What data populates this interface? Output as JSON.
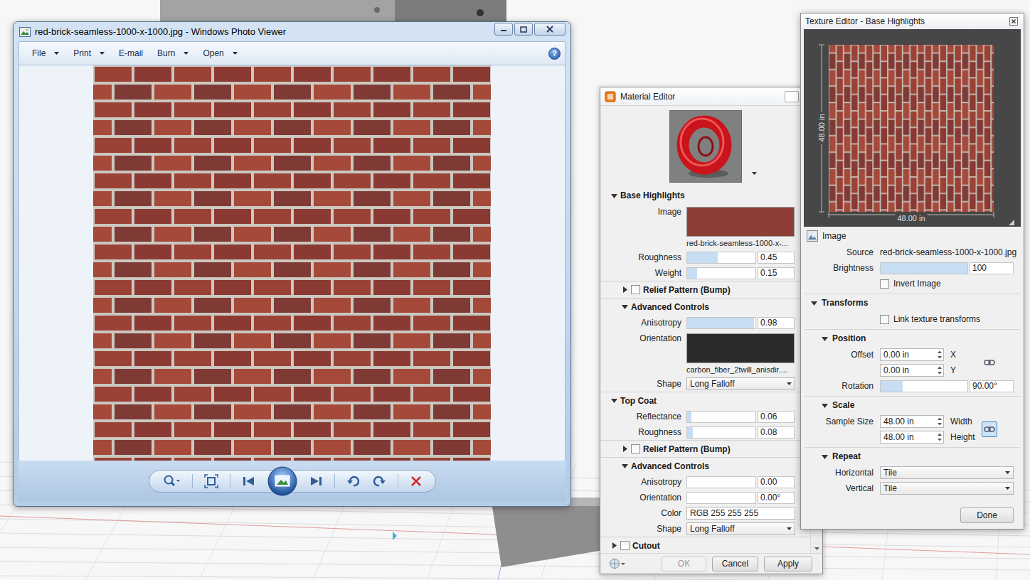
{
  "photo_viewer": {
    "title": "red-brick-seamless-1000-x-1000.jpg - Windows Photo Viewer",
    "menu": [
      {
        "label": "File",
        "has_dropdown": true
      },
      {
        "label": "Print",
        "has_dropdown": true
      },
      {
        "label": "E-mail",
        "has_dropdown": false
      },
      {
        "label": "Burn",
        "has_dropdown": true
      },
      {
        "label": "Open",
        "has_dropdown": true
      }
    ],
    "help": "?"
  },
  "material_editor": {
    "title": "Material Editor",
    "rows": [
      {
        "kind": "section",
        "label": "Base Highlights",
        "expanded": true,
        "has_checkbox": false
      },
      {
        "kind": "image",
        "label": "Image",
        "file": "red-brick-seamless-1000-x-...",
        "color": "#8e3f35"
      },
      {
        "kind": "slider",
        "label": "Roughness",
        "level": 0.45,
        "value": "0.45"
      },
      {
        "kind": "slider",
        "label": "Weight",
        "level": 0.15,
        "value": "0.15"
      },
      {
        "kind": "subsection",
        "label": "Relief Pattern (Bump)",
        "expanded": false,
        "has_checkbox": true,
        "checked": false
      },
      {
        "kind": "subsection",
        "label": "Advanced Controls",
        "expanded": true,
        "has_checkbox": false
      },
      {
        "kind": "slider",
        "label": "Anisotropy",
        "level": 0.98,
        "value": "0.98"
      },
      {
        "kind": "image",
        "label": "Orientation",
        "file": "carbon_fiber_2twill_anisdir....",
        "color": "#2b2b2b"
      },
      {
        "kind": "select",
        "label": "Shape",
        "value": "Long Falloff"
      },
      {
        "kind": "section",
        "label": "Top Coat",
        "expanded": true,
        "has_checkbox": false
      },
      {
        "kind": "slider",
        "label": "Reflectance",
        "level": 0.06,
        "value": "0.06"
      },
      {
        "kind": "slider",
        "label": "Roughness",
        "level": 0.08,
        "value": "0.08"
      },
      {
        "kind": "subsection",
        "label": "Relief Pattern (Bump)",
        "expanded": false,
        "has_checkbox": true,
        "checked": false
      },
      {
        "kind": "subsection",
        "label": "Advanced Controls",
        "expanded": true,
        "has_checkbox": false
      },
      {
        "kind": "slider",
        "label": "Anisotropy",
        "level": 0,
        "value": "0.00"
      },
      {
        "kind": "slider",
        "label": "Orientation",
        "level": 0,
        "value": "0.00°"
      },
      {
        "kind": "field",
        "label": "Color",
        "value": "RGB 255 255 255"
      },
      {
        "kind": "select",
        "label": "Shape",
        "value": "Long Falloff"
      },
      {
        "kind": "section",
        "label": "Cutout",
        "expanded": false,
        "has_checkbox": true,
        "checked": false
      }
    ],
    "buttons": [
      {
        "label": "OK",
        "disabled": true
      },
      {
        "label": "Cancel",
        "disabled": false
      },
      {
        "label": "Apply",
        "disabled": false
      }
    ]
  },
  "texture_editor": {
    "title": "Texture Editor - Base Highlights",
    "preview": {
      "height_label": "48.00 in",
      "width_label": "48.00 in"
    },
    "image_header": "Image",
    "source": {
      "label": "Source",
      "value": "red-brick-seamless-1000-x-1000.jpg"
    },
    "brightness": {
      "label": "Brightness",
      "level": 1,
      "value": "100"
    },
    "invert": {
      "label": "Invert Image",
      "checked": false
    },
    "transforms": {
      "label": "Transforms",
      "expanded": true,
      "link": {
        "label": "Link texture transforms",
        "checked": false
      }
    },
    "position": {
      "label": "Position",
      "expanded": true,
      "offset_label": "Offset",
      "x": {
        "value": "0.00 in",
        "axis": "X"
      },
      "y": {
        "value": "0.00 in",
        "axis": "Y"
      },
      "linked": false,
      "rotation": {
        "label": "Rotation",
        "level": 0.25,
        "value": "90.00°"
      }
    },
    "scale": {
      "label": "Scale",
      "expanded": true,
      "size_label": "Sample Size",
      "width": {
        "value": "48.00 in",
        "axis": "Width"
      },
      "height": {
        "value": "48.00 in",
        "axis": "Height"
      },
      "linked": true
    },
    "repeat": {
      "label": "Repeat",
      "expanded": true,
      "rows": [
        {
          "label": "Horizontal",
          "value": "Tile"
        },
        {
          "label": "Vertical",
          "value": "Tile"
        }
      ]
    },
    "done": "Done"
  }
}
